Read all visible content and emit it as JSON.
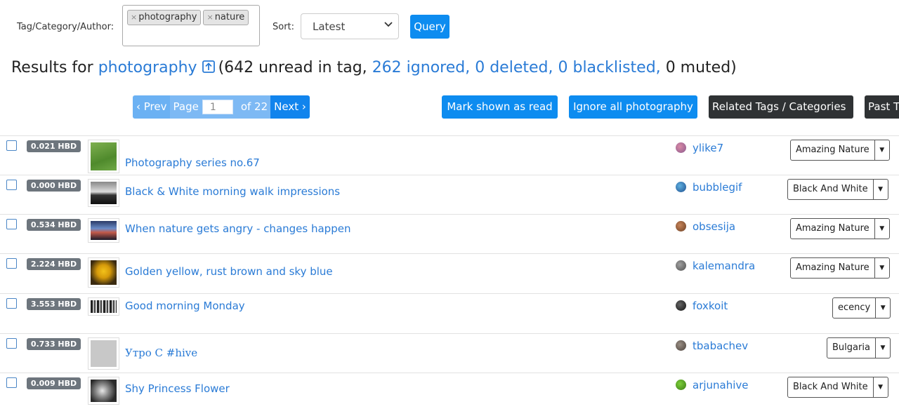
{
  "filters": {
    "tag_label": "Tag/Category/Author:",
    "tags": [
      "photography",
      "nature"
    ],
    "sort_label": "Sort:",
    "sort_value": "Latest",
    "query_label": "Query"
  },
  "results": {
    "prefix": "Results for",
    "tag": "photography",
    "open_paren": "(",
    "unread": "642 unread in tag,",
    "ignored": "262 ignored,",
    "deleted": "0 deleted,",
    "blacklisted": "0 blacklisted,",
    "muted": "0 muted)"
  },
  "pager": {
    "prev": "‹ Prev",
    "page": "Page",
    "page_value": "1",
    "of": "of 22",
    "next": "Next ›"
  },
  "actions": {
    "mark_read": "Mark shown as read",
    "ignore_all": "Ignore all photography",
    "related": "Related Tags / Categories",
    "past": "Past T"
  },
  "rows": [
    {
      "hbd": "0.021 HBD",
      "title": "Photography series no.67",
      "author": "ylike7",
      "category": "Amazing Nature"
    },
    {
      "hbd": "0.000 HBD",
      "title": "Black & White morning walk impressions",
      "author": "bubblegif",
      "category": "Black And White"
    },
    {
      "hbd": "0.534 HBD",
      "title": "When nature gets angry - changes happen",
      "author": "obsesija",
      "category": "Amazing Nature"
    },
    {
      "hbd": "2.224 HBD",
      "title": "Golden yellow, rust brown and sky blue",
      "author": "kalemandra",
      "category": "Amazing Nature"
    },
    {
      "hbd": "3.553 HBD",
      "title": "Good morning Monday",
      "author": "foxkoit",
      "category": "ecency"
    },
    {
      "hbd": "0.733 HBD",
      "title": "Утро С #hive",
      "author": "tbabachev",
      "category": "Bulgaria"
    },
    {
      "hbd": "0.009 HBD",
      "title": "Shy Princess Flower",
      "author": "arjunahive",
      "category": "Black And White"
    }
  ],
  "colors": {
    "link": "#2a7bd6",
    "primary_button": "#0d8cf0",
    "dark_button": "#2f3234",
    "hbd_badge": "#6d757d"
  }
}
